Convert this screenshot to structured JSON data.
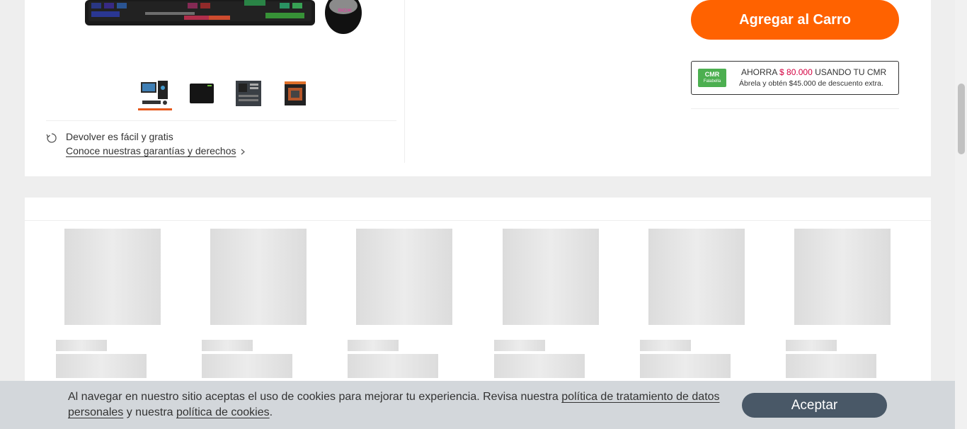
{
  "product": {
    "add_to_cart_label": "Agregar al Carro",
    "thumbnails": [
      {
        "name": "pc-setup-thumbnail",
        "active": true
      },
      {
        "name": "mousepad-thumbnail",
        "active": false
      },
      {
        "name": "motherboard-thumbnail",
        "active": false
      },
      {
        "name": "cpu-box-thumbnail",
        "active": false
      }
    ],
    "returns": {
      "text": "Devolver es fácil y gratis",
      "link": "Conoce nuestras garantías y derechos"
    },
    "cmr_promo": {
      "logo_text": "CMR",
      "logo_sub": "Falabella",
      "prefix": "AHORRA",
      "amount": "$ 80.000",
      "suffix": "USANDO TU CMR",
      "detail": "Ábrela y obtén $45.000 de descuento extra."
    }
  },
  "cookie_banner": {
    "text_before": "Al navegar en nuestro sitio aceptas el uso de cookies para mejorar tu experiencia. Revisa nuestra ",
    "privacy_link": "política de tratamiento de datos personales",
    "text_middle": " y nuestra ",
    "cookies_link": "política de cookies",
    "text_end": ".",
    "accept_label": "Aceptar"
  },
  "colors": {
    "accent": "#ff6200",
    "promo_price": "#d40040",
    "accept_button": "#495867",
    "cmr_green": "#4caf50"
  }
}
